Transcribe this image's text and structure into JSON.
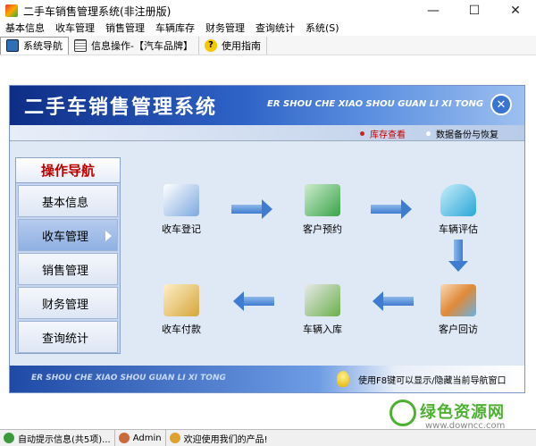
{
  "window": {
    "title": "二手车销售管理系统(非注册版)",
    "controls": [
      "—",
      "☐",
      "✕"
    ]
  },
  "menubar": {
    "items": [
      "基本信息",
      "收车管理",
      "销售管理",
      "车辆库存",
      "财务管理",
      "查询统计",
      "系统(S)"
    ]
  },
  "toolbar": {
    "items": [
      {
        "label": "系统导航",
        "icon": "nav-icon"
      },
      {
        "label": "信息操作-【汽车品牌】",
        "icon": "info-icon"
      },
      {
        "label": "使用指南",
        "icon": "help-icon"
      }
    ]
  },
  "banner": {
    "title": "二手车销售管理系统",
    "pinyin": "ER SHOU CHE XIAO SHOU GUAN LI XI TONG",
    "close_glyph": "✕"
  },
  "subbar": {
    "inventory_link": "库存查看",
    "backup_link": "数据备份与恢复",
    "inventory_dot_color": "#d02020",
    "backup_dot_color": "#ffffff"
  },
  "sidebar": {
    "header": "操作导航",
    "items": [
      "基本信息",
      "收车管理",
      "销售管理",
      "财务管理",
      "查询统计"
    ],
    "active_index": 1
  },
  "workflow": {
    "nodes": [
      {
        "label": "收车登记",
        "icon": "register-icon",
        "color": "#7ea8e0"
      },
      {
        "label": "客户预约",
        "icon": "appointment-icon",
        "color": "#3aa34a"
      },
      {
        "label": "车辆评估",
        "icon": "car-icon",
        "color": "#2aa6d8"
      },
      {
        "label": "客户回访",
        "icon": "people-icon",
        "color": "#e08a3a"
      },
      {
        "label": "车辆入库",
        "icon": "warehouse-icon",
        "color": "#6ab04c"
      },
      {
        "label": "收车付款",
        "icon": "payment-icon",
        "color": "#d6a53a"
      }
    ]
  },
  "footer": {
    "pinyin": "ER SHOU CHE XIAO SHOU GUAN LI XI TONG",
    "tip": "使用F8键可以显示/隐藏当前导航窗口"
  },
  "statusbar": {
    "auto_tip": "自动提示信息(共5项)...",
    "user": "Admin",
    "welcome": "欢迎使用我们的产品!"
  },
  "watermark": {
    "main": "绿色资源网",
    "sub": "www.downcc.com"
  }
}
